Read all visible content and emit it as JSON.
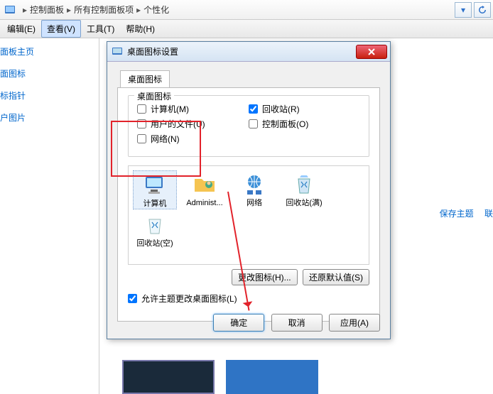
{
  "breadcrumb": {
    "p1": "控制面板",
    "p2": "所有控制面板项",
    "p3": "个性化"
  },
  "menubar": {
    "edit": "编辑(E)",
    "view": "查看(V)",
    "tools": "工具(T)",
    "help": "帮助(H)"
  },
  "sidebar": {
    "items": [
      {
        "label": "面板主页"
      },
      {
        "label": "面图标"
      },
      {
        "label": "标指针"
      },
      {
        "label": "户图片"
      }
    ]
  },
  "rightlinks": {
    "save": "保存主题",
    "link2": "联"
  },
  "dialog": {
    "title": "桌面图标设置",
    "tab": "桌面图标",
    "group_title": "桌面图标",
    "checks": {
      "computer": "计算机(M)",
      "userfiles": "用户的文件(U)",
      "network": "网络(N)",
      "recycle": "回收站(R)",
      "controlpanel": "控制面板(O)"
    },
    "icons": [
      {
        "label": "计算机"
      },
      {
        "label": "Administ..."
      },
      {
        "label": "网络"
      },
      {
        "label": "回收站(满)"
      },
      {
        "label": "回收站(空)"
      }
    ],
    "change_icon": "更改图标(H)...",
    "restore": "还原默认值(S)",
    "allow": "允许主题更改桌面图标(L)",
    "ok": "确定",
    "cancel": "取消",
    "apply": "应用(A)"
  }
}
